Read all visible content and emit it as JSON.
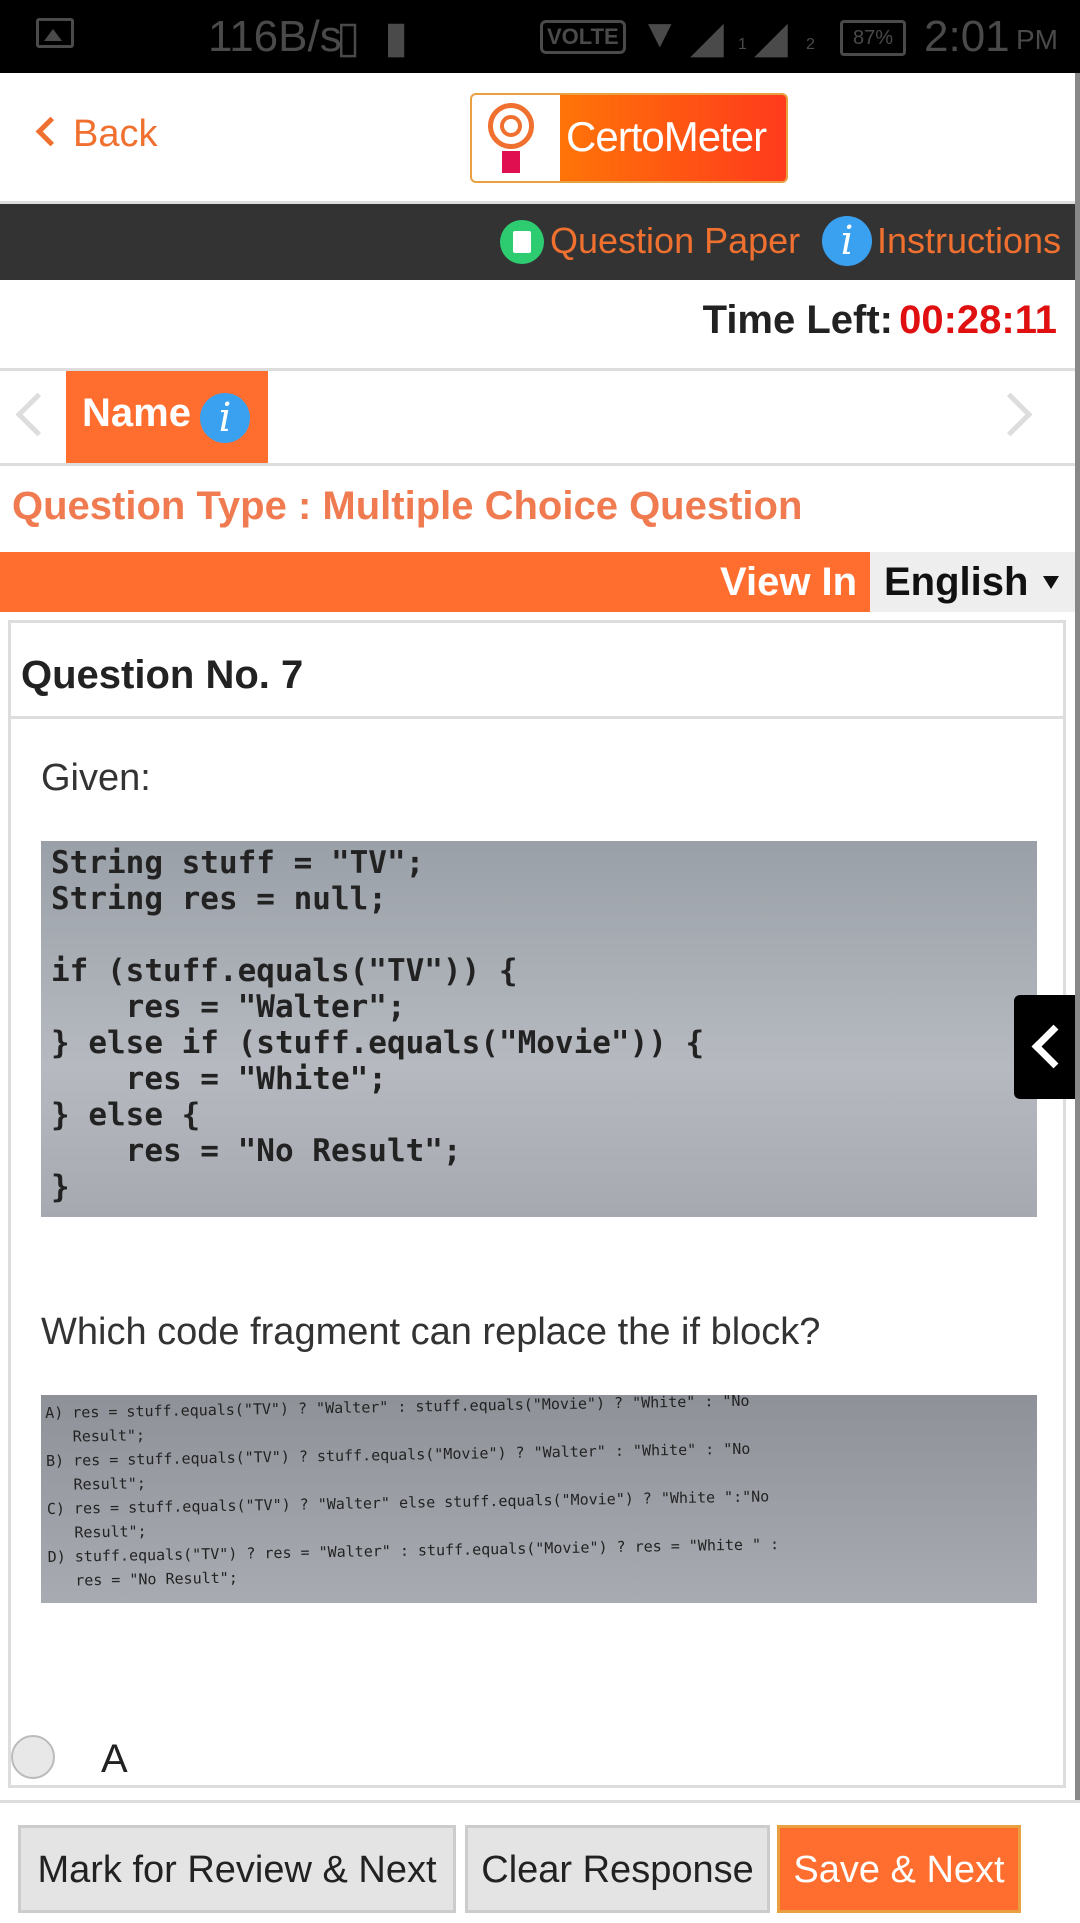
{
  "status_bar": {
    "speed": "116B/s",
    "volte": "VOLTE",
    "sim1": "1",
    "sim2": "2",
    "battery": "87%",
    "time": "2:01",
    "ampm": "PM"
  },
  "header": {
    "back_label": "Back",
    "logo_text": "CertoMeter"
  },
  "toolbar": {
    "question_paper": "Question Paper",
    "instructions": "Instructions",
    "info_glyph": "i"
  },
  "timer": {
    "label": "Time Left:",
    "value": "00:28:11"
  },
  "section_tab": {
    "name": "Name",
    "info_glyph": "i"
  },
  "question_type": "Question Type : Multiple Choice Question",
  "view_in": {
    "label": "View In",
    "language": "English"
  },
  "question": {
    "number_label": "Question No. 7",
    "given": "Given:",
    "code_image_text": "String stuff = \"TV\";\nString res = null;\n\nif (stuff.equals(\"TV\")) {\n    res = \"Walter\";\n} else if (stuff.equals(\"Movie\")) {\n    res = \"White\";\n} else {\n    res = \"No Result\";\n}",
    "prompt": "Which code fragment can replace the if block?",
    "options_image_text": "A) res = stuff.equals(\"TV\") ? \"Walter\" : stuff.equals(\"Movie\") ? \"White\" : \"No\n   Result\";\nB) res = stuff.equals(\"TV\") ? stuff.equals(\"Movie\") ? \"Walter\" : \"White\" : \"No\n   Result\";\nC) res = stuff.equals(\"TV\") ? \"Walter\" else stuff.equals(\"Movie\") ? \"White \":\"No\n   Result\";\nD) stuff.equals(\"TV\") ? res = \"Walter\" : stuff.equals(\"Movie\") ? res = \"White \" :\n   res = \"No Result\";",
    "options": [
      {
        "label": "A"
      }
    ]
  },
  "buttons": {
    "mark_review": "Mark for Review & Next",
    "clear": "Clear Response",
    "save_next": "Save & Next"
  },
  "colors": {
    "accent": "#ff6e2e",
    "timer": "#e01010",
    "toolbar_bg": "#333333"
  }
}
